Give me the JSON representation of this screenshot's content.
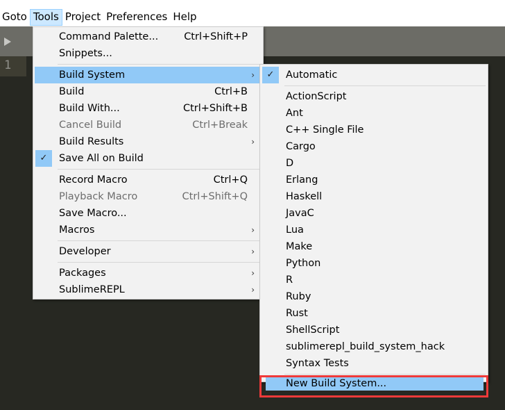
{
  "menubar": {
    "items": [
      "Goto",
      "Tools",
      "Project",
      "Preferences",
      "Help"
    ],
    "active": "Tools"
  },
  "editor": {
    "line_numbers": [
      "1"
    ]
  },
  "tools_menu": {
    "groups": [
      [
        {
          "label": "Command Palette...",
          "shortcut": "Ctrl+Shift+P"
        },
        {
          "label": "Snippets...",
          "shortcut": ""
        }
      ],
      [
        {
          "label": "Build System",
          "submenu": true,
          "highlighted": true
        },
        {
          "label": "Build",
          "shortcut": "Ctrl+B"
        },
        {
          "label": "Build With...",
          "shortcut": "Ctrl+Shift+B"
        },
        {
          "label": "Cancel Build",
          "shortcut": "Ctrl+Break",
          "disabled": true
        },
        {
          "label": "Build Results",
          "submenu": true
        },
        {
          "label": "Save All on Build",
          "checked": true
        }
      ],
      [
        {
          "label": "Record Macro",
          "shortcut": "Ctrl+Q"
        },
        {
          "label": "Playback Macro",
          "shortcut": "Ctrl+Shift+Q",
          "disabled": true
        },
        {
          "label": "Save Macro...",
          "shortcut": ""
        },
        {
          "label": "Macros",
          "submenu": true
        }
      ],
      [
        {
          "label": "Developer",
          "submenu": true
        }
      ],
      [
        {
          "label": "Packages",
          "submenu": true
        },
        {
          "label": "SublimeREPL",
          "submenu": true
        }
      ]
    ]
  },
  "build_system_menu": {
    "automatic": {
      "label": "Automatic",
      "checked": true
    },
    "systems": [
      "ActionScript",
      "Ant",
      "C++ Single File",
      "Cargo",
      "D",
      "Erlang",
      "Haskell",
      "JavaC",
      "Lua",
      "Make",
      "Python",
      "R",
      "Ruby",
      "Rust",
      "ShellScript",
      "sublimerepl_build_system_hack",
      "Syntax Tests"
    ],
    "new_build_system": {
      "label": "New Build System...",
      "highlighted": true
    }
  },
  "icons": {
    "check": "✓",
    "submenu_arrow": "›",
    "play": "play-triangle"
  },
  "colors": {
    "highlight": "#91c9f7",
    "callout": "#ef3a3a",
    "editor_bg": "#272822"
  }
}
